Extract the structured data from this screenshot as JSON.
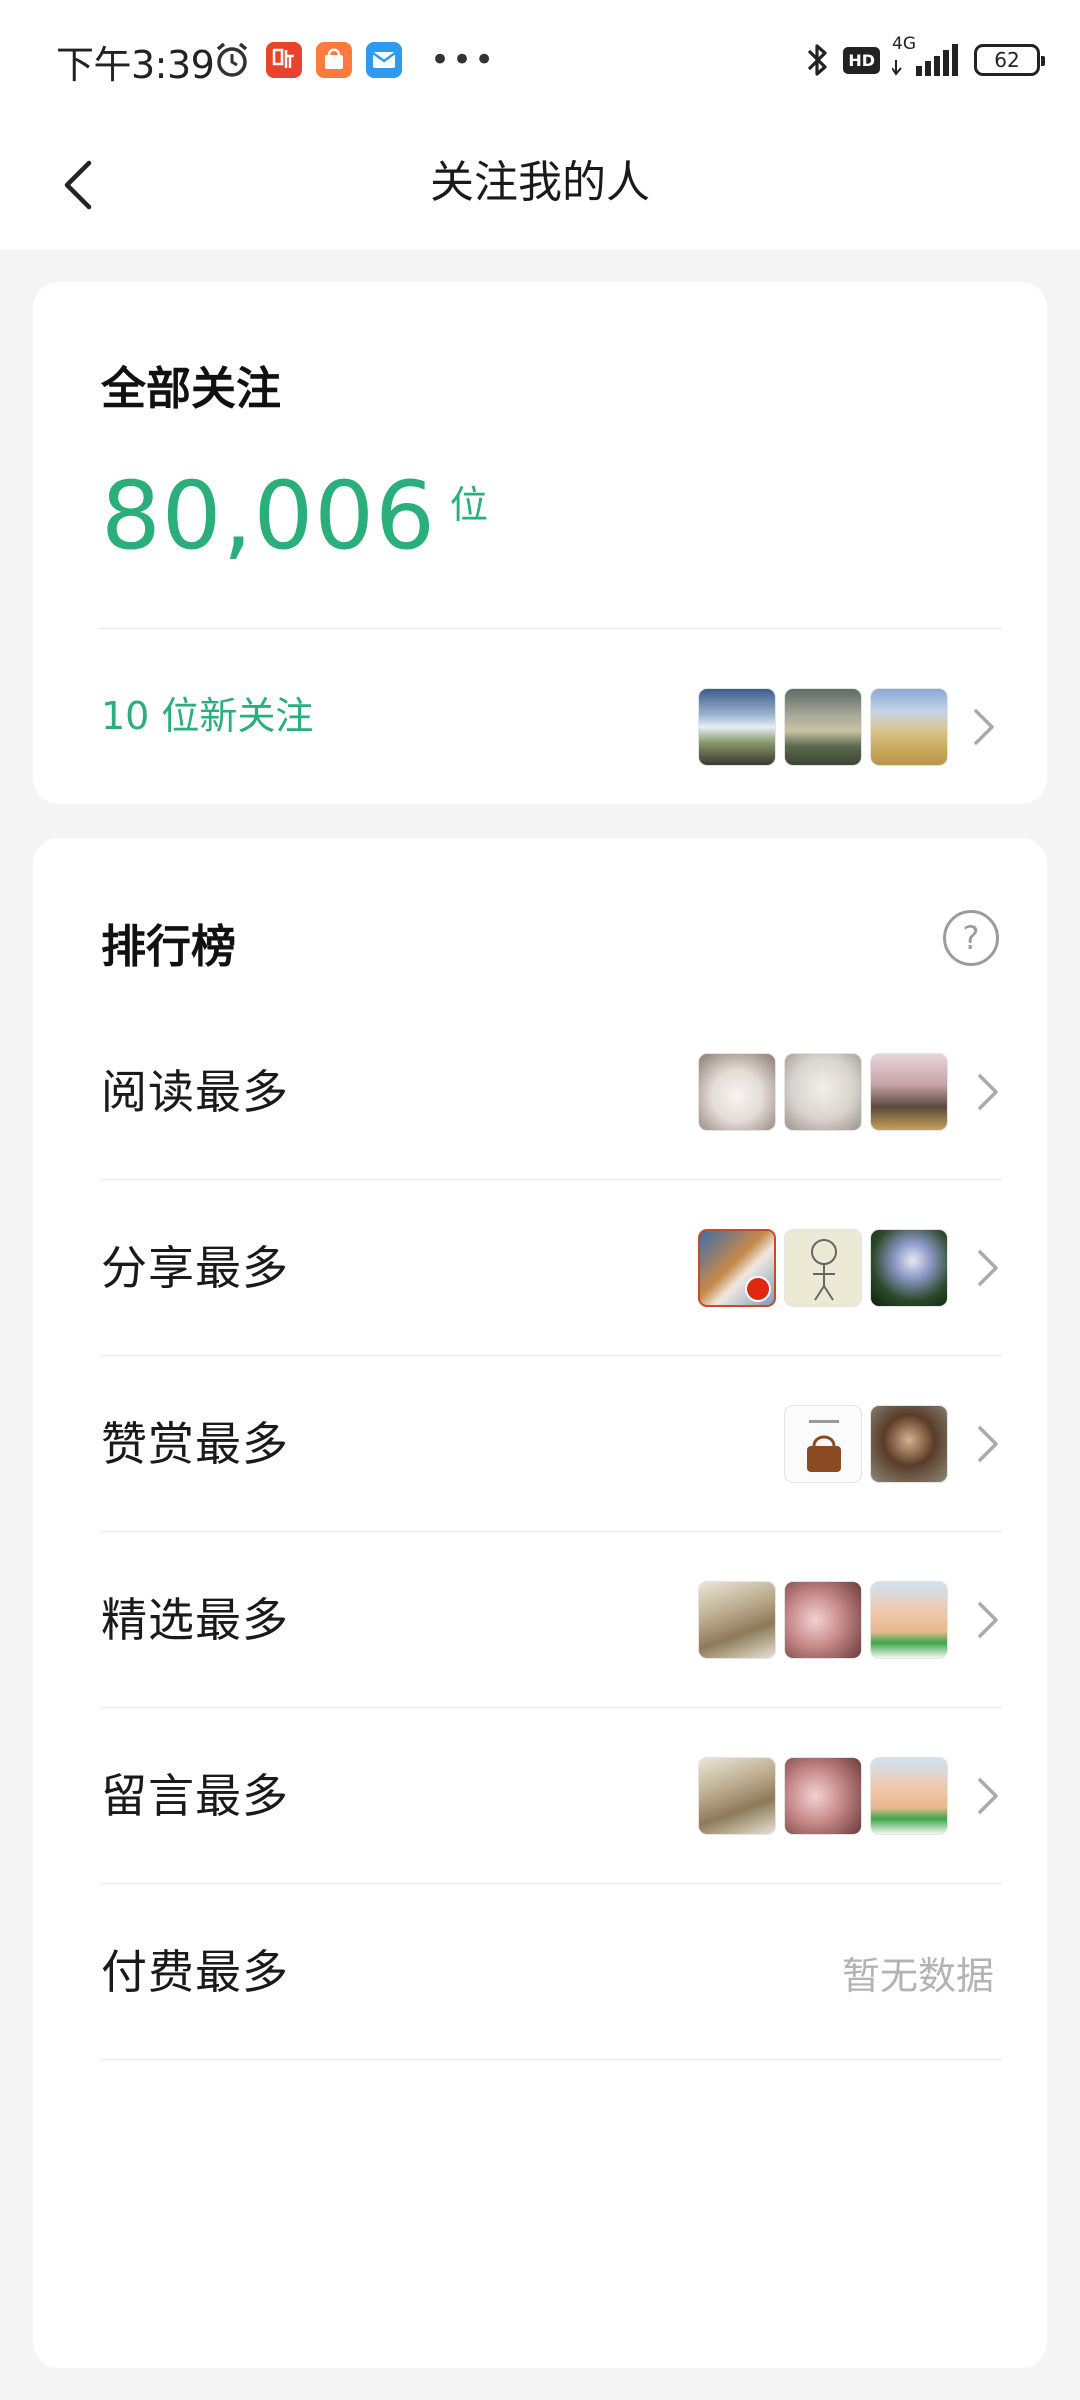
{
  "status_bar": {
    "time": "下午3:39",
    "network": "4G",
    "hd_label": "HD",
    "battery": "62"
  },
  "nav": {
    "title": "关注我的人"
  },
  "total_card": {
    "title": "全部关注",
    "count": "80,006",
    "unit": "位",
    "new_followers": "10 位新关注"
  },
  "ranking": {
    "title": "排行榜",
    "help_symbol": "?",
    "rows": [
      {
        "label": "阅读最多"
      },
      {
        "label": "分享最多"
      },
      {
        "label": "赞赏最多"
      },
      {
        "label": "精选最多"
      },
      {
        "label": "留言最多"
      },
      {
        "label": "付费最多",
        "empty_text": "暂无数据"
      }
    ]
  },
  "colors": {
    "accent": "#2aae7b",
    "muted": "#b3b3b3"
  }
}
